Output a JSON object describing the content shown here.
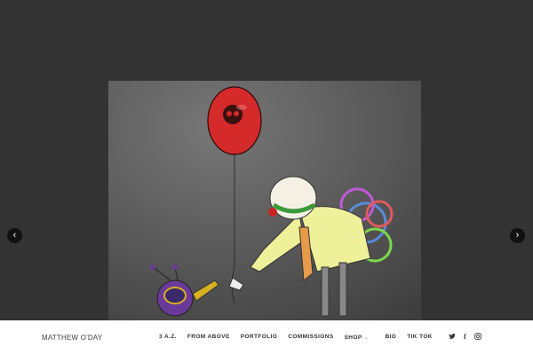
{
  "site": {
    "brand": "MATTHEW O'DAY"
  },
  "menu": [
    {
      "label": "3 A.Z."
    },
    {
      "label": "FROM ABOVE"
    },
    {
      "label": "PORTFOLIO"
    },
    {
      "label": "COMMISSIONS"
    },
    {
      "label": "SHOP",
      "caret": "⌄"
    },
    {
      "label": "BIO"
    },
    {
      "label": "TIK TOK"
    }
  ],
  "social": [
    {
      "icon": "twitter-icon",
      "glyph": "🐦"
    },
    {
      "icon": "facebook-icon",
      "glyph": "f"
    },
    {
      "icon": "instagram-icon",
      "glyph": "◙"
    }
  ],
  "slider": {
    "prev": "‹",
    "next": "›"
  },
  "colors": {
    "background": "#333333",
    "balloon": "#d42a2a",
    "footer": "#ffffff"
  }
}
